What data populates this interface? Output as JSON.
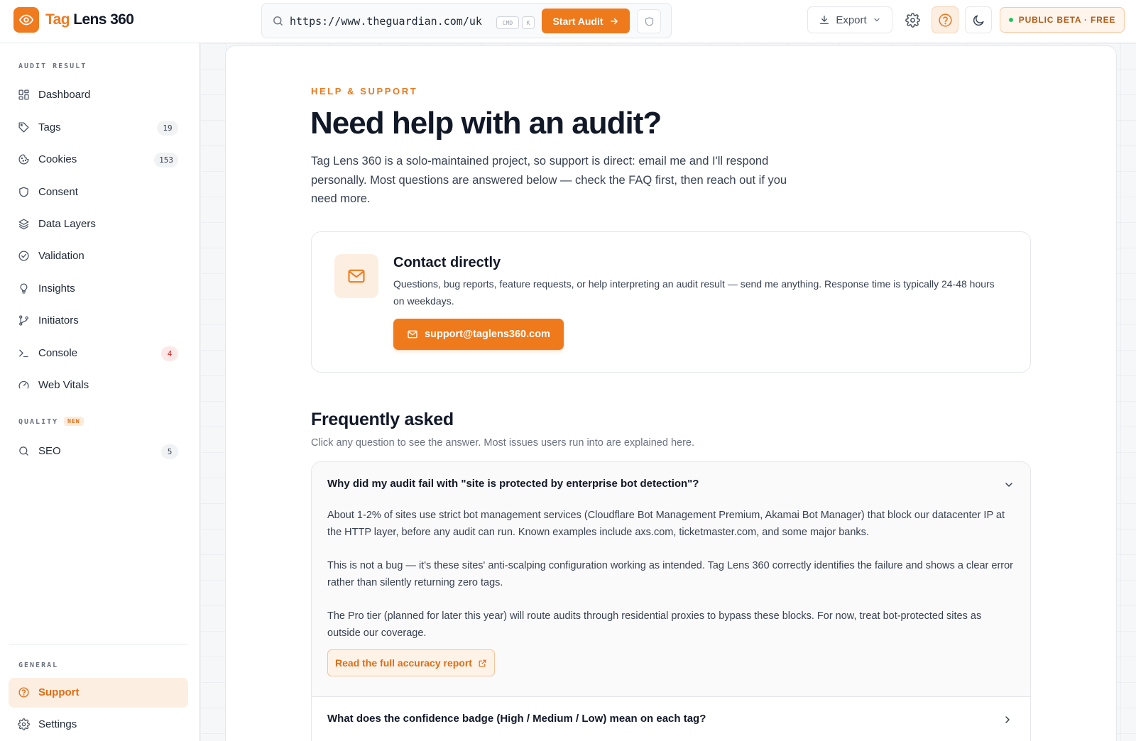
{
  "brand": {
    "name_accent": "Tag",
    "name_rest": " Lens 360"
  },
  "toolbar": {
    "url_value": "https://www.theguardian.com/uk",
    "kbd_cmd": "CMD",
    "kbd_k": "K",
    "start_audit_label": "Start Audit",
    "export_label": "Export",
    "beta_badge": "PUBLIC BETA · FREE"
  },
  "sidebar": {
    "section_audit": "AUDIT RESULT",
    "section_quality": "QUALITY",
    "quality_new": "NEW",
    "section_general": "GENERAL",
    "items": [
      {
        "label": "Dashboard",
        "icon": "dashboard-icon"
      },
      {
        "label": "Tags",
        "count": "19",
        "icon": "tag-icon"
      },
      {
        "label": "Cookies",
        "count": "153",
        "icon": "cookie-icon"
      },
      {
        "label": "Consent",
        "icon": "shield-icon"
      },
      {
        "label": "Data Layers",
        "icon": "layers-icon"
      },
      {
        "label": "Validation",
        "icon": "check-circle-icon"
      },
      {
        "label": "Insights",
        "icon": "lightbulb-icon"
      },
      {
        "label": "Initiators",
        "icon": "git-branch-icon"
      },
      {
        "label": "Console",
        "count": "4",
        "icon": "terminal-icon"
      },
      {
        "label": "Web Vitals",
        "icon": "gauge-icon"
      }
    ],
    "quality_items": [
      {
        "label": "SEO",
        "count": "5",
        "icon": "search-icon"
      }
    ],
    "general_items": [
      {
        "label": "Support",
        "icon": "help-circle-icon",
        "active": true
      },
      {
        "label": "Settings",
        "icon": "gear-icon"
      }
    ]
  },
  "main": {
    "eyebrow": "HELP & SUPPORT",
    "title": "Need help with an audit?",
    "intro": "Tag Lens 360 is a solo-maintained project, so support is direct: email me and I'll respond personally. Most questions are answered below — check the FAQ first, then reach out if you need more.",
    "contact": {
      "title": "Contact directly",
      "description": "Questions, bug reports, feature requests, or help interpreting an audit result — send me anything. Response time is typically 24-48 hours on weekdays.",
      "email_button": "support@taglens360.com"
    },
    "faq": {
      "title": "Frequently asked",
      "subtitle": "Click any question to see the answer. Most issues users run into are explained here.",
      "items": [
        {
          "question": "Why did my audit fail with \"site is protected by enterprise bot detection\"?",
          "expanded": true,
          "paragraphs": [
            "About 1-2% of sites use strict bot management services (Cloudflare Bot Management Premium, Akamai Bot Manager) that block our datacenter IP at the HTTP layer, before any audit can run. Known examples include axs.com, ticketmaster.com, and some major banks.",
            "This is not a bug — it's these sites' anti-scalping configuration working as intended. Tag Lens 360 correctly identifies the failure and shows a clear error rather than silently returning zero tags.",
            "The Pro tier (planned for later this year) will route audits through residential proxies to bypass these blocks. For now, treat bot-protected sites as outside our coverage."
          ],
          "link_label": "Read the full accuracy report"
        },
        {
          "question": "What does the confidence badge (High / Medium / Low) mean on each tag?",
          "expanded": false
        }
      ]
    }
  },
  "colors": {
    "accent": "#ef7a1c",
    "accent_soft": "#fdeee2",
    "text": "#111827",
    "danger": "#dc2626",
    "success": "#22c55e"
  }
}
